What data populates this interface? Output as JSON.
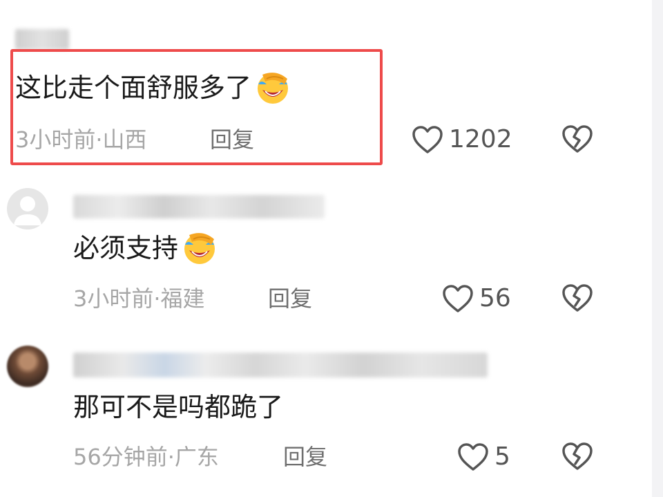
{
  "comments": [
    {
      "text": "这比走个面舒服多了",
      "emoji": "face-palm-laughing-emoji",
      "time_location": "3小时前·山西",
      "reply_label": "回复",
      "like_count": "1202"
    },
    {
      "text": "必须支持",
      "emoji": "face-palm-laughing-emoji",
      "time_location": "3小时前·福建",
      "reply_label": "回复",
      "like_count": "56"
    },
    {
      "text": "那可不是吗都跪了",
      "time_location": "56分钟前·广东",
      "reply_label": "回复",
      "like_count": "5"
    }
  ],
  "icons": {
    "like": "heart-outline-icon",
    "dislike": "broken-heart-icon"
  },
  "colors": {
    "highlight_border": "#ee4b4b",
    "meta_text": "#a6a6a6",
    "reply_text": "#6f6f6f",
    "icon_stroke": "#555555"
  }
}
